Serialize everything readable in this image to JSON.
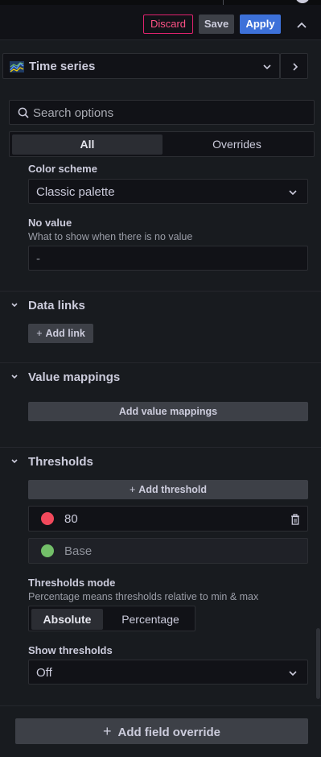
{
  "toolbar": {
    "discard_label": "Discard",
    "save_label": "Save",
    "apply_label": "Apply"
  },
  "visualization": {
    "label": "Time series",
    "icon": "time-series-chart-icon"
  },
  "search": {
    "placeholder": "Search options",
    "value": ""
  },
  "tabs": [
    {
      "label": "All",
      "selected": true
    },
    {
      "label": "Overrides",
      "selected": false
    }
  ],
  "standard_options": {
    "color_scheme_label": "Color scheme",
    "color_scheme_value": "Classic palette",
    "no_value_label": "No value",
    "no_value_description": "What to show when there is no value",
    "no_value_input": "-"
  },
  "sections": {
    "data_links": {
      "title": "Data links",
      "button": "Add link"
    },
    "value_mappings": {
      "title": "Value mappings",
      "button": "Add value mappings"
    },
    "thresholds": {
      "title": "Thresholds",
      "add_button": "Add threshold",
      "items": [
        {
          "value": "80",
          "color": "#f2495c"
        },
        {
          "value": "Base",
          "color": "#73bf69"
        }
      ],
      "mode_label": "Thresholds mode",
      "mode_description": "Percentage means thresholds relative to min & max",
      "mode_options": [
        "Absolute",
        "Percentage"
      ],
      "mode_selected": "Absolute",
      "show_label": "Show thresholds",
      "show_value": "Off"
    }
  },
  "footer": {
    "add_override_label": "Add field override"
  },
  "colors": {
    "background": "#181b1f",
    "accent_blue": "#3d71d9",
    "discard_pink": "#e0226e"
  }
}
